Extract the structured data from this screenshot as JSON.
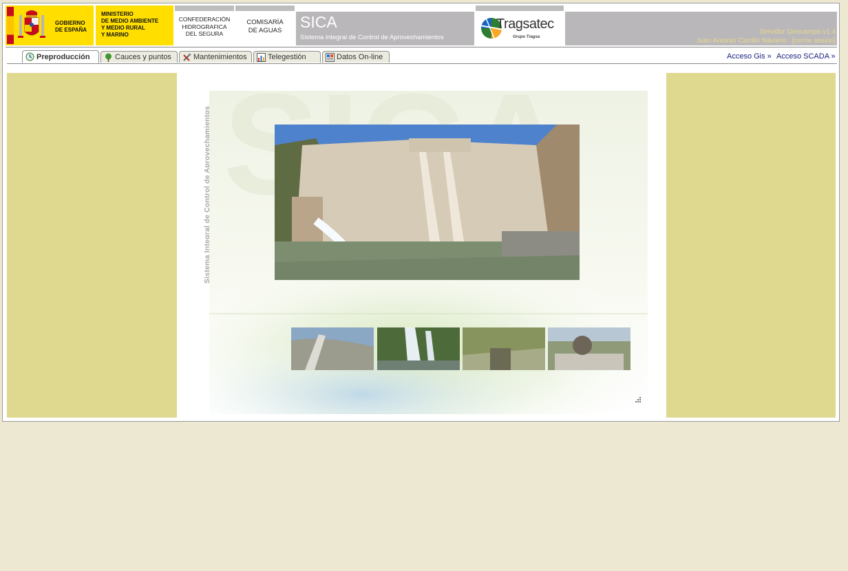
{
  "header": {
    "gobierno": [
      "GOBIERNO",
      "DE ESPAÑA"
    ],
    "ministerio": [
      "MINISTERIO",
      "DE MEDIO AMBIENTE",
      "Y MEDIO RURAL",
      "Y MARINO"
    ],
    "confederacion": [
      "CONFEDERACIÓN",
      "HIDROGRAFICA",
      "DEL SEGURA"
    ],
    "comisaria": [
      "COMISARÍA",
      "DE AGUAS"
    ],
    "app_title": "SICA",
    "app_subtitle": "Sistema integral de Control de Aprovechamientos",
    "brand_name": "Tragsatec",
    "brand_group": "Grupo Tragsa",
    "server": "Servidor Geocampo v1.4",
    "user": "Juan Antonio Carrillo Navarro : [cerrar sesión]"
  },
  "tabs": [
    {
      "label": "Preproducción",
      "icon": "preproduction-icon",
      "active": true
    },
    {
      "label": "Cauces y puntos",
      "icon": "tree-icon",
      "active": false
    },
    {
      "label": "Mantenimientos",
      "icon": "tools-icon",
      "active": false
    },
    {
      "label": "Telegestión",
      "icon": "chart-icon",
      "active": false
    },
    {
      "label": "Datos On-line",
      "icon": "data-icon",
      "active": false
    }
  ],
  "links": {
    "gis": "Acceso Gis »",
    "scada": "Acceso SCADA »"
  },
  "main": {
    "vertical_title": "Sistema Integral de Control de Aprovechamientos",
    "watermark": "SICA"
  },
  "colors": {
    "page_bg": "#ece8d2",
    "side_panel": "#dfd98f",
    "header_grey": "#b9b7ba",
    "gov_yellow": "#ffde00",
    "header_text_gold": "#e9d98a",
    "link_blue": "#1a237e"
  }
}
